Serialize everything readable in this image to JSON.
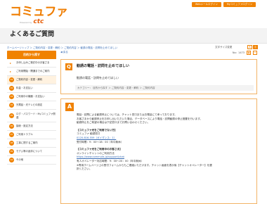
{
  "header": {
    "logo_main": "コミュファ",
    "logo_powered": "Powered by",
    "logo_brand": "ctc",
    "web_mail_button": "Webメールログイン",
    "my_commufa_button": "Myコミュファログイン"
  },
  "page_title": "よくあるご質問",
  "breadcrumb": "ホームページトップ ＞ ご契約内容・変更・解約 ＞ ご契約内容 ＞ 勧誘の電話・訪問を止めてほしい",
  "text_size": {
    "label": "文字サイズ変更",
    "large": "大",
    "small": "小"
  },
  "sidebar": {
    "head": "目的から探す",
    "items": [
      {
        "label": "お申し込みご検討中のお客さま",
        "kind": "arrow"
      },
      {
        "label": "ご利用開始・開通までのご案内",
        "kind": "arrow"
      },
      {
        "num": "01",
        "label": "ご契約内容・変更・解約"
      },
      {
        "num": "02",
        "label": "料金・お支払い"
      },
      {
        "num": "03",
        "label": "ご利用中の機器・お支払い"
      },
      {
        "num": "04",
        "label": "光電話・光テレビの設定"
      },
      {
        "num": "05",
        "label": "ログ・パスワード・Myコミュファ関連"
      },
      {
        "num": "06",
        "label": "接続・設定方法"
      },
      {
        "num": "07",
        "label": "ご利用トラブル"
      },
      {
        "num": "08",
        "label": "工事に関するご案内"
      },
      {
        "num": "09",
        "label": "モデム等の返却について"
      },
      {
        "num": "10",
        "label": "その他"
      }
    ]
  },
  "main": {
    "back_link": "戻る",
    "faq_no": "No：1473",
    "print_icon": "print-icon",
    "question": {
      "badge": "Q",
      "title": "勧誘の電話・訪問を止めてほしい",
      "text": "勧誘の電話・訪問を止めてほしい",
      "category": "カテゴリー： 目的から探す ＞ ご契約内容・変更・解約 ＞ ご契約内容"
    },
    "answer": {
      "badge": "A",
      "lines": [
        {
          "text": "電話・訪問による勧誘停止については、チャット窓口またはお電話にて承っております。",
          "style": "normal"
        },
        {
          "text": "お客さまから勧誘停止をお申し出いただいた場合、データベースにより電話・訪問勧誘の停止措置を行います。",
          "style": "normal"
        },
        {
          "text": "勧誘停止をご希望の場合は下記窓口までお問い合わせください。",
          "style": "normal"
        },
        {
          "text": "",
          "style": "gap"
        },
        {
          "text": "【コミュファ光をご利用でない方】",
          "style": "head"
        },
        {
          "text": "コミュファ 勧誘窓口",
          "style": "normal"
        },
        {
          "text": "0120-816-559（ガイダンス：1）",
          "style": "link"
        },
        {
          "text": "受付時間：9：00～18：00（年中無休）",
          "style": "normal"
        },
        {
          "text": "",
          "style": "gap"
        },
        {
          "text": "【コミュファ光をご利用中のお客さま】",
          "style": "head"
        },
        {
          "text": "オンラインチャットのご利用方法",
          "style": "normal"
        },
        {
          "text": "https://www.commufa.jp/support/chat",
          "style": "link"
        },
        {
          "text": "有人オペレーター対応時間：9：00～20：00（年中無休）",
          "style": "normal"
        },
        {
          "text": "※専用ホームページ上の受付フォームからもご連絡いただけます。チャット画面を表示後【チャットオペレーター】を選",
          "style": "normal"
        },
        {
          "text": "択ください。",
          "style": "normal"
        }
      ]
    }
  },
  "colors": {
    "brand_orange": "#f08200",
    "link_blue": "#3a6db5"
  }
}
